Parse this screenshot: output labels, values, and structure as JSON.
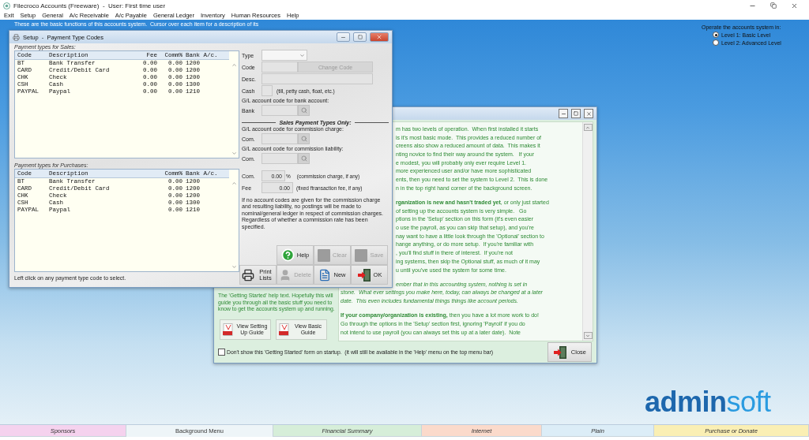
{
  "window": {
    "title": "Filecroco Accounts (Freeware)  -  User: First time user"
  },
  "menu": [
    "Exit",
    "Setup",
    "General",
    "A/c Receivable",
    "A/c Payable",
    "General Ledger",
    "Inventory",
    "Human Resources",
    "Help"
  ],
  "banner": "These are the basic functions of this accounts system.  Cursor over each item for a description of its",
  "level_selector": {
    "title": "Operate the accounts system in:",
    "options": [
      {
        "label": "Level 1: Basic Level",
        "selected": true
      },
      {
        "label": "Level 2: Advanced Level",
        "selected": false
      }
    ]
  },
  "setup_dialog": {
    "title": "Setup  -  Payment Type Codes",
    "sales": {
      "caption": "Payment types for Sales:",
      "columns": [
        "Code",
        "Description",
        "Fee",
        "Comm%",
        "Bank A/c."
      ],
      "rows": [
        [
          "BT",
          "Bank Transfer",
          "0.00",
          "0.00",
          "1200"
        ],
        [
          "CARD",
          "Credit/Debit Card",
          "0.00",
          "0.00",
          "1200"
        ],
        [
          "CHK",
          "Check",
          "0.00",
          "0.00",
          "1200"
        ],
        [
          "CSH",
          "Cash",
          "0.00",
          "0.00",
          "1300"
        ],
        [
          "PAYPAL",
          "Paypal",
          "0.00",
          "0.00",
          "1210"
        ]
      ]
    },
    "purchases": {
      "caption": "Payment types for Purchases:",
      "columns": [
        "Code",
        "Description",
        "Comm%",
        "Bank A/c."
      ],
      "rows": [
        [
          "BT",
          "Bank Transfer",
          "0.00",
          "1200"
        ],
        [
          "CARD",
          "Credit/Debit Card",
          "0.00",
          "1200"
        ],
        [
          "CHK",
          "Check",
          "0.00",
          "1200"
        ],
        [
          "CSH",
          "Cash",
          "0.00",
          "1300"
        ],
        [
          "PAYPAL",
          "Paypal",
          "0.00",
          "1210"
        ]
      ]
    },
    "status": "Left click on any payment type code to select.",
    "form": {
      "type_label": "Type",
      "code_label": "Code",
      "change_code": "Change Code",
      "desc_label": "Desc.",
      "cash_label": "Cash",
      "cash_checked": false,
      "cash_hint": "(till, petty cash, float, etc.)",
      "bank_caption": "G/L account code for bank account:",
      "bank_label": "Bank",
      "section_title": "Sales Payment Types Only:",
      "charge_caption": "G/L account code for commission charge:",
      "charge_label": "Com.",
      "liability_caption": "G/L account code for commission liability:",
      "liability_label": "Com.",
      "rate_label": "Com.",
      "rate_value": "0.00",
      "rate_unit": "%",
      "rate_hint": "(commission charge, if any)",
      "fee_label": "Fee",
      "fee_value": "0.00",
      "fee_hint": "(fixed ftransaction fee, if any)",
      "note": "If no account codes are given for the commission charge and resulting liability, no postings will be made to nominal/general ledger in respect of commission charges.  Regardless of whether a commission rate has been specified."
    },
    "buttons_top": [
      {
        "kind": "help",
        "label": "Help",
        "disabled": false
      },
      {
        "kind": "blank",
        "label": "Clear",
        "disabled": true
      },
      {
        "kind": "blank",
        "label": "Save",
        "disabled": true
      }
    ],
    "buttons_bottom": [
      {
        "kind": "print",
        "label": "Print Lists",
        "disabled": false
      },
      {
        "kind": "person",
        "label": "Delete",
        "disabled": true
      },
      {
        "kind": "new",
        "label": "New",
        "disabled": false
      },
      {
        "kind": "exit",
        "label": "OK",
        "disabled": false
      }
    ]
  },
  "getting_started": {
    "paragraphs": [
      {
        "beside_dialog": [
          "m has two levels of operation.  When first installed it starts",
          "is it's most basic mode.  This provides a reduced number of",
          "creens also show a reduced amount of data.  This makes it",
          "nting novice to find their way around the system.   If your",
          "e modest, you will probably only ever require Level 1.",
          "more experienced user and/or have more sophisticated",
          "ents, then you need to set the system to Level 2.  This is done",
          "n in the top right hand corner of the background screen."
        ]
      },
      {
        "beside_dialog": [
          "**rganization is new and hasn't traded yet**, or only just started",
          "of setting up the accounts system is very simple.   Go",
          "ptions in the 'Setup' section on this form (it's even easier",
          "o use the payroll, as you can skip that setup), and you're",
          "nay want to have a little look through the 'Optional' section to",
          "hange anything, or do more setup.  If you're familiar with",
          ", you'll find stuff in there of interest.  If you're not",
          "ing systems, then skip the Optional stuff, as much of it may",
          "u until you've used the system for some time."
        ]
      },
      {
        "beside_dialog": [
          "*ember that in this accounting system, nothing is set in*"
        ],
        "below_dialog": [
          "*stone.  What ever settings you make here, today, can always be changed at a later*",
          "*date.  This even includes fundamental things things like account periods.*"
        ]
      },
      {
        "below_dialog": [
          "**If your company/organization is existing,** then you have a lot more work to do!",
          "Go through the options in the 'Setup' section first, ignoring 'Payroll' if you do",
          "not intend to use payroll (you can always set this up at a later date).  Note"
        ]
      }
    ],
    "blurb": "The 'Getting Started' help text.  Hopefully this will guide you through all the basic stuff you need to know to get the accounts system up and running.",
    "guides": [
      "View Setting Up Guide",
      "View Basic Guide"
    ],
    "dont_show": {
      "label": "Don't show this 'Getting Started' form on startup.  (it will still be available in the 'Help' menu on the top menu bar)",
      "checked": false
    },
    "close": "Close"
  },
  "logo": [
    "admin",
    "soft"
  ],
  "bottom_tabs": [
    {
      "label": "Sponsors",
      "color": "#f5d2ee",
      "selected": false
    },
    {
      "label": "Background Menu",
      "color": "#eef5f8",
      "selected": true
    },
    {
      "label": "Financial Summary",
      "color": "#d6eed9",
      "selected": false
    },
    {
      "label": "Internet",
      "color": "#fbdacb",
      "selected": false
    },
    {
      "label": "Plain",
      "color": "#dcedf7",
      "selected": false
    },
    {
      "label": "Purchase or Donate",
      "color": "#faefb4",
      "selected": false
    }
  ]
}
